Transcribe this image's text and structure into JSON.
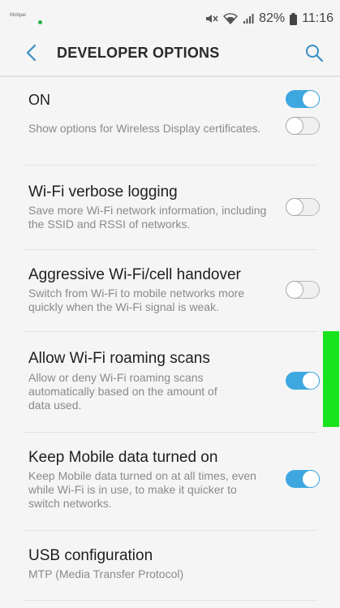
{
  "status_bar": {
    "left_text": "Mobpai",
    "battery_percent": "82%",
    "time": "11:16"
  },
  "app_bar": {
    "title": "DEVELOPER OPTIONS",
    "back_icon": "chevron-left-icon",
    "search_icon": "search-icon"
  },
  "master_toggle": {
    "label": "ON",
    "enabled": true
  },
  "items": [
    {
      "title": "",
      "subtitle": "Show options for Wireless Display certificates.",
      "enabled": false
    },
    {
      "title": "Wi-Fi verbose logging",
      "subtitle": "Save more Wi-Fi network information, including the SSID and RSSI of networks.",
      "enabled": false
    },
    {
      "title": "Aggressive Wi-Fi/cell handover",
      "subtitle": "Switch from Wi-Fi to mobile networks more quickly when the Wi-Fi signal is weak.",
      "enabled": false
    },
    {
      "title": "Allow Wi-Fi roaming scans",
      "subtitle": "Allow or deny Wi-Fi roaming scans automatically based on the amount of data used.",
      "enabled": true
    },
    {
      "title": "Keep Mobile data turned on",
      "subtitle": "Keep Mobile data turned on at all times, even while Wi-Fi is in use, to make it quicker to switch networks.",
      "enabled": true
    },
    {
      "title": "USB configuration",
      "subtitle": "MTP (Media Transfer Protocol)"
    }
  ],
  "colors": {
    "toggle_on": "#3ea7e0",
    "background": "#f5f5f5",
    "highlight": "#19e31c"
  }
}
